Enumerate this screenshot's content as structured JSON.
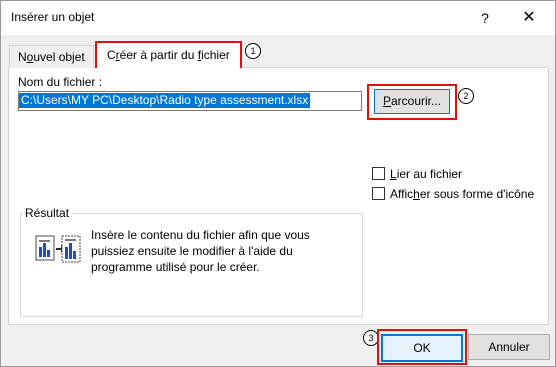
{
  "dialog": {
    "title": "Insérer un objet",
    "help_glyph": "?",
    "close_glyph": "✕"
  },
  "tabs": [
    {
      "label_pre": "N",
      "label_u": "o",
      "label_post": "uvel objet"
    },
    {
      "label_pre": "C",
      "label_u": "r",
      "label_post": "éer à partir du ",
      "label_u2": "f",
      "label_post2": "ichier"
    }
  ],
  "file": {
    "label": "Nom du fichier :",
    "value": "C:\\Users\\MY PC\\Desktop\\Radio type assessment.xlsx",
    "browse_pre": "",
    "browse_u": "P",
    "browse_post": "arcourir..."
  },
  "options": {
    "link_u": "L",
    "link_post": "ier au fichier",
    "icon_pre": "Affic",
    "icon_u": "h",
    "icon_post": "er sous forme d'icône"
  },
  "result": {
    "title": "Résultat",
    "text": "Insère le contenu du fichier afin que vous puissiez ensuite le modifier à l'aide du programme utilisé pour le créer."
  },
  "buttons": {
    "ok": "OK",
    "cancel": "Annuler"
  },
  "markers": [
    "1",
    "2",
    "3"
  ],
  "colors": {
    "highlight": "#e01010",
    "accent": "#0078d7"
  }
}
